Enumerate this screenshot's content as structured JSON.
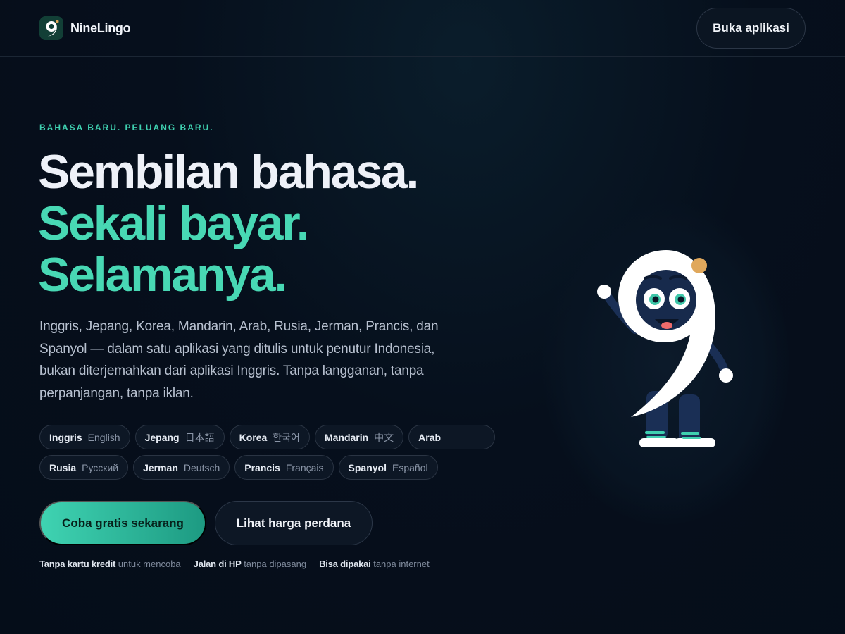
{
  "header": {
    "brand_name": "NineLingo",
    "open_app_label": "Buka aplikasi"
  },
  "hero": {
    "eyebrow": "BAHASA BARU. PELUANG BARU.",
    "headline_line1": "Sembilan bahasa.",
    "headline_line2": "Sekali bayar.",
    "headline_line3": "Selamanya.",
    "lede": "Inggris, Jepang, Korea, Mandarin, Arab, Rusia, Jerman, Prancis, dan Spanyol — dalam satu aplikasi yang ditulis untuk penutur Indonesia, bukan diterjemahkan dari aplikasi Inggris. Tanpa langganan, tanpa perpanjangan, tanpa iklan."
  },
  "languages": [
    {
      "name": "Inggris",
      "native": "English"
    },
    {
      "name": "Jepang",
      "native": "日本語"
    },
    {
      "name": "Korea",
      "native": "한국어"
    },
    {
      "name": "Mandarin",
      "native": "中文"
    },
    {
      "name": "Arab",
      "native": ""
    },
    {
      "name": "Rusia",
      "native": "Русский"
    },
    {
      "name": "Jerman",
      "native": "Deutsch"
    },
    {
      "name": "Prancis",
      "native": "Français"
    },
    {
      "name": "Spanyol",
      "native": "Español"
    }
  ],
  "cta": {
    "primary_label": "Coba gratis sekarang",
    "secondary_label": "Lihat harga perdana"
  },
  "notes": [
    {
      "strong": "Tanpa kartu kredit",
      "rest": "untuk mencoba"
    },
    {
      "strong": "Jalan di HP",
      "rest": "tanpa dipasang"
    },
    {
      "strong": "Bisa dipakai",
      "rest": "tanpa internet"
    }
  ],
  "colors": {
    "background": "#050f1c",
    "accent": "#48d8b4",
    "text_primary": "#eef1f8",
    "text_muted": "#b7c0cf"
  },
  "icons": {
    "brand": "nine-logo-icon",
    "mascot": "nine-mascot-illustration"
  }
}
